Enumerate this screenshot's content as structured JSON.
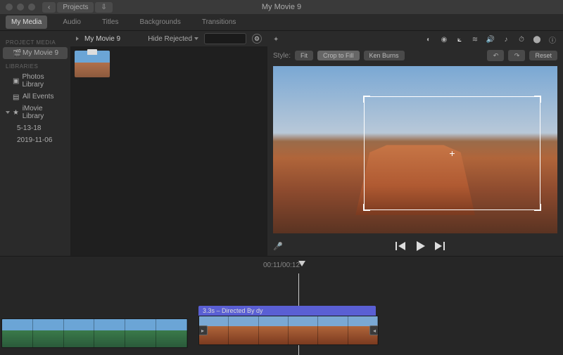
{
  "window": {
    "title": "My Movie 9"
  },
  "nav": {
    "back": "‹",
    "projects": "Projects",
    "import": "⇩"
  },
  "tabs": [
    "My Media",
    "Audio",
    "Titles",
    "Backgrounds",
    "Transitions"
  ],
  "active_tab": 0,
  "sidebar": {
    "project_header": "PROJECT MEDIA",
    "project": "My Movie 9",
    "libs_header": "LIBRARIES",
    "items": [
      "Photos Library",
      "All Events",
      "iMovie Library"
    ],
    "dates": [
      "5-13-18",
      "2019-11-06"
    ]
  },
  "browser": {
    "title": "My Movie 9",
    "filter": "Hide Rejected",
    "search_placeholder": ""
  },
  "viewer": {
    "style_label": "Style:",
    "style_buttons": [
      "Fit",
      "Crop to Fill",
      "Ken Burns"
    ],
    "reset": "Reset"
  },
  "time": {
    "current": "00:11",
    "total": "00:12",
    "sep": " / "
  },
  "clip": {
    "duration": "3.3s",
    "title": "Directed By dy",
    "sep": " – "
  }
}
